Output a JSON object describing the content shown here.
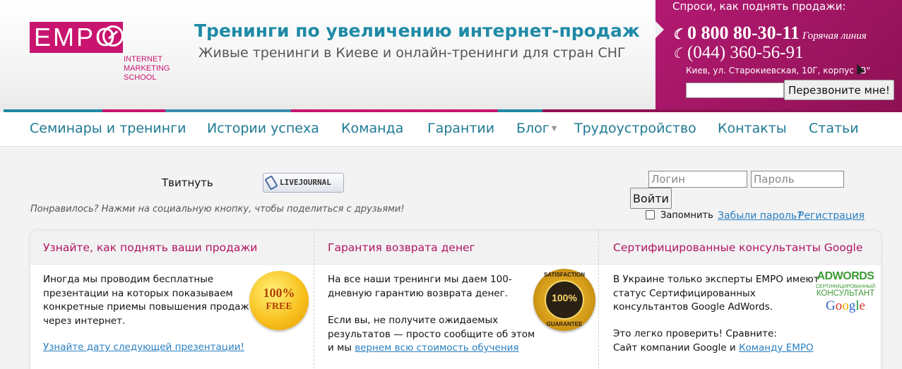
{
  "header": {
    "logo_text": "EMPO",
    "logo_sub": [
      "INTERNET",
      "MARKETING",
      "SCHOOL"
    ],
    "title": "Тренинги по увеличению интернет-продаж",
    "subtitle": "Живые тренинги в Киеве и онлайн-тренинги для стран СНГ"
  },
  "contact": {
    "ask": "Спроси, как поднять продажи:",
    "phone1": "0 800 80-30-11",
    "hotline": "Горячая линия",
    "phone2": "(044) 360-56-91",
    "address": "Киев, ул. Старокиевская, 10Г, корпус \"В\"",
    "callback_button": "Перезвоните мне!"
  },
  "nav": {
    "items": [
      "Семинары и тренинги",
      "Истории успеха",
      "Команда",
      "Гарантии",
      "Блог",
      "Трудоустройство",
      "Контакты",
      "Статьи"
    ]
  },
  "social": {
    "tweet": "Твитнуть",
    "livejournal": "LIVEJOURNAL",
    "hint": "Понравилось? Нажми на социальную кнопку, чтобы поделиться с друзьями!"
  },
  "login": {
    "login_placeholder": "Логин",
    "password_placeholder": "Пароль",
    "submit": "Войти",
    "remember": "Запомнить",
    "forgot": "Забыли пароль?",
    "register": "Регистрация"
  },
  "panels": [
    {
      "title": "Узнайте, как поднять ваши продажи",
      "lines": [
        "Иногда мы проводим бесплатные",
        "презентации на которых показываем",
        "конкретные приемы повышения продаж",
        "через интернет."
      ],
      "link": "Узнайте дату следующей презентации!",
      "badge_pct": "100%",
      "badge_text": "FREE"
    },
    {
      "title": "Гарантия возврата денег",
      "lines": [
        "На все наши тренинги мы даем 100-",
        "дневную гарантию возврата денег."
      ],
      "lines2": [
        "Если вы, не получите ожидаемых",
        "результатов — просто сообщите об этом"
      ],
      "last_prefix": "и мы ",
      "link": "вернем всю стоимость обучения",
      "badge_pct": "100%",
      "badge_top": "SATISFACTION",
      "badge_bottom": "GUARANTEE"
    },
    {
      "title": "Сертифицированные консультанты Google",
      "lines": [
        "В Украине только эксперты EMPO имеют",
        "статус Сертифицированных",
        "консультантов Google AdWords."
      ],
      "lines2": [
        "Это легко проверить! Сравните:"
      ],
      "last_prefix": "Сайт компании Google и ",
      "link": "Команду EMPO",
      "badge_aw": "ADWORDS",
      "badge_cert": "СЕРТИФИЦИРОВАННЫЙ",
      "badge_kons": "КОНСУЛЬТАНТ",
      "badge_google": [
        "G",
        "o",
        "o",
        "g",
        "l",
        "e"
      ]
    }
  ]
}
